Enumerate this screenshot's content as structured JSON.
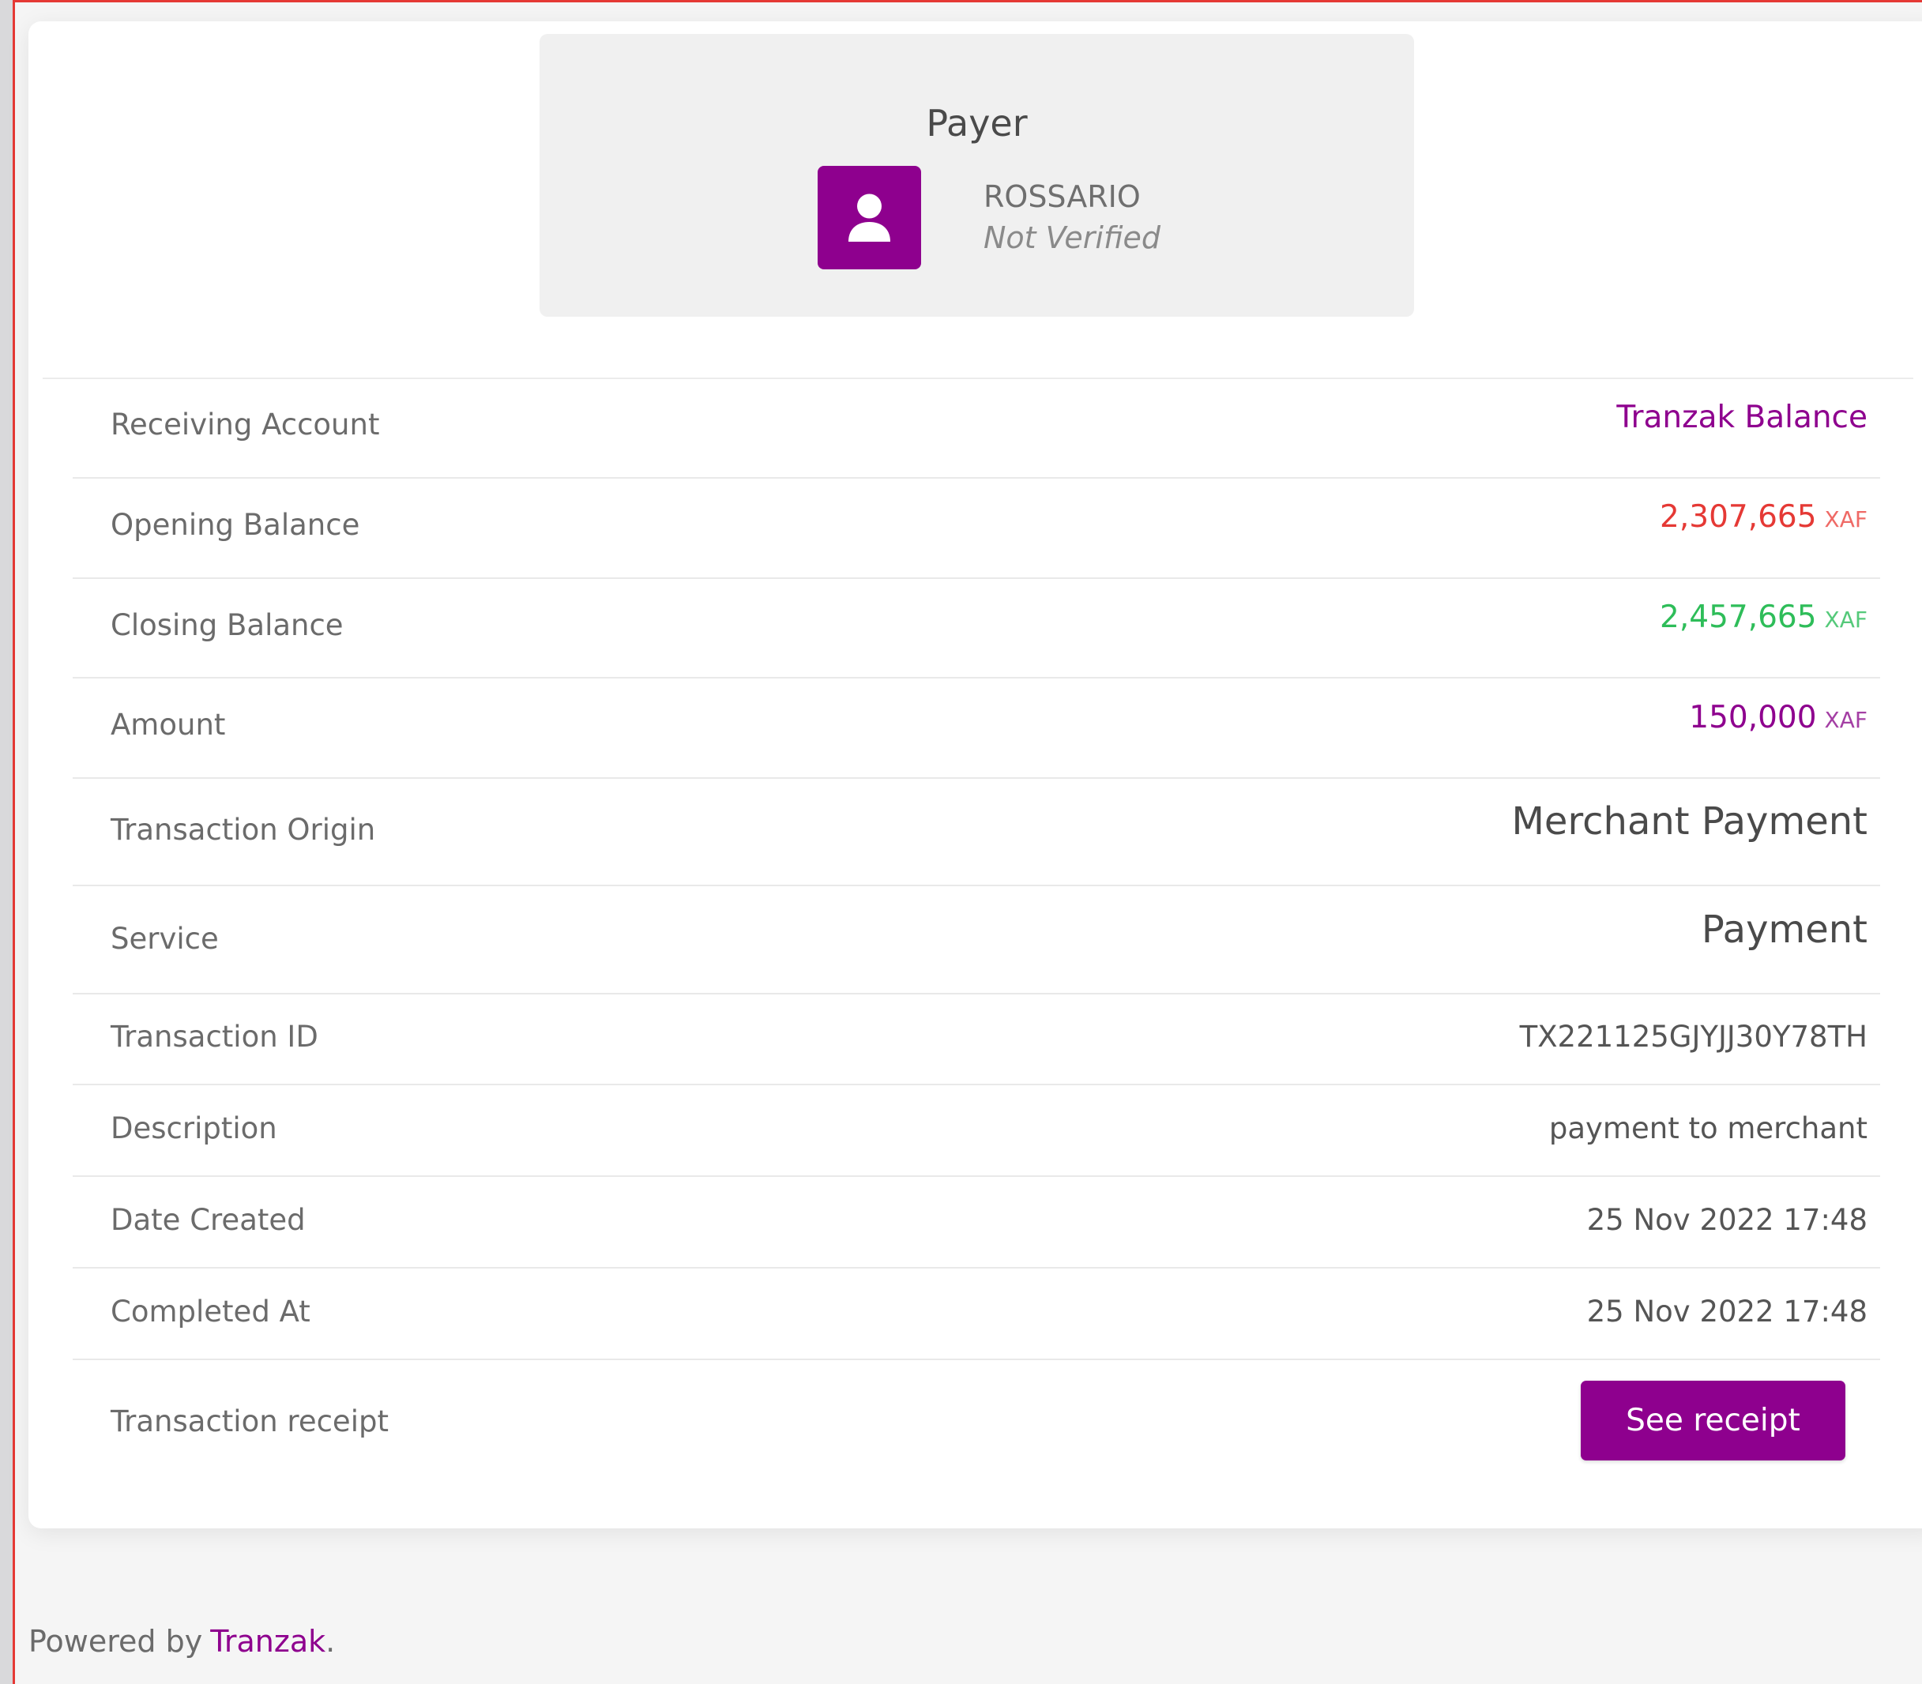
{
  "payer": {
    "title": "Payer",
    "name": "ROSSARIO",
    "status": "Not Verified"
  },
  "rows": [
    {
      "label": "Receiving Account",
      "value": "Tranzak Balance"
    },
    {
      "label": "Opening Balance",
      "value": "2,307,665",
      "currency": "XAF"
    },
    {
      "label": "Closing Balance",
      "value": "2,457,665",
      "currency": "XAF"
    },
    {
      "label": "Amount",
      "value": "150,000",
      "currency": "XAF"
    },
    {
      "label": "Transaction Origin",
      "value": "Merchant Payment"
    },
    {
      "label": "Service",
      "value": "Payment"
    },
    {
      "label": "Transaction ID",
      "value": "TX221125GJYJJ30Y78TH"
    },
    {
      "label": "Description",
      "value": "payment to merchant"
    },
    {
      "label": "Date Created",
      "value": "25 Nov 2022 17:48"
    },
    {
      "label": "Completed At",
      "value": "25 Nov 2022 17:48"
    },
    {
      "label": "Transaction receipt"
    }
  ],
  "receipt_button": {
    "label": "See receipt"
  },
  "footer": {
    "prefix": "Powered by",
    "brand": "Tranzak",
    "suffix": "."
  },
  "colors": {
    "brand_purple": "#8e008e",
    "opening_red": "#e53935",
    "closing_green": "#2ebd59"
  }
}
